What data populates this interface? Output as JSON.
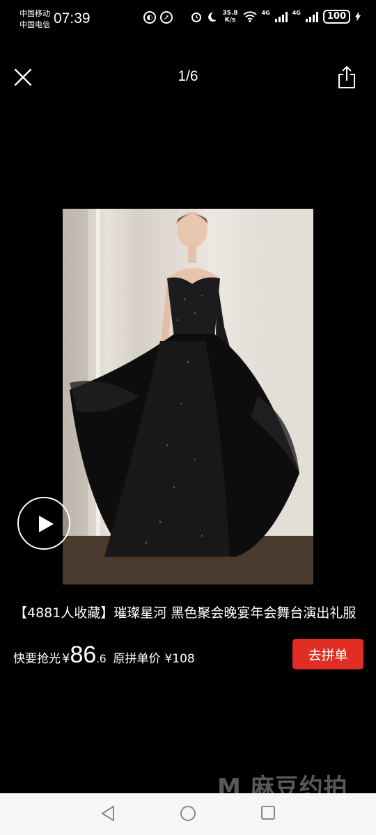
{
  "status_bar": {
    "carrier_1": "中国移动",
    "carrier_2": "中国电信",
    "time": "07:39",
    "speed_value": "35.8",
    "speed_unit": "K/s",
    "battery": "100",
    "network_1": "4G",
    "network_2": "4G",
    "icons": [
      "hd-call-icon",
      "speed-icon",
      "alarm-icon",
      "moon-icon",
      "wifi-icon",
      "signal-icon",
      "battery-icon",
      "charging-icon"
    ]
  },
  "viewer": {
    "counter": "1/6",
    "close_icon": "close-icon",
    "share_icon": "share-icon"
  },
  "product": {
    "title": "【4881人收藏】璀璨星河 黑色聚会晚宴年会舞台演出礼服",
    "price_label": "快要抢光",
    "currency": "¥",
    "price_int": "86",
    "price_dec": ".6",
    "original_label": "原拼单价",
    "original_price": "¥108",
    "buy_label": "去拼单"
  },
  "colors": {
    "background": "#000000",
    "accent": "#e02e24",
    "nav_bar": "#f6f6f6"
  },
  "watermark": "麻豆约拍"
}
